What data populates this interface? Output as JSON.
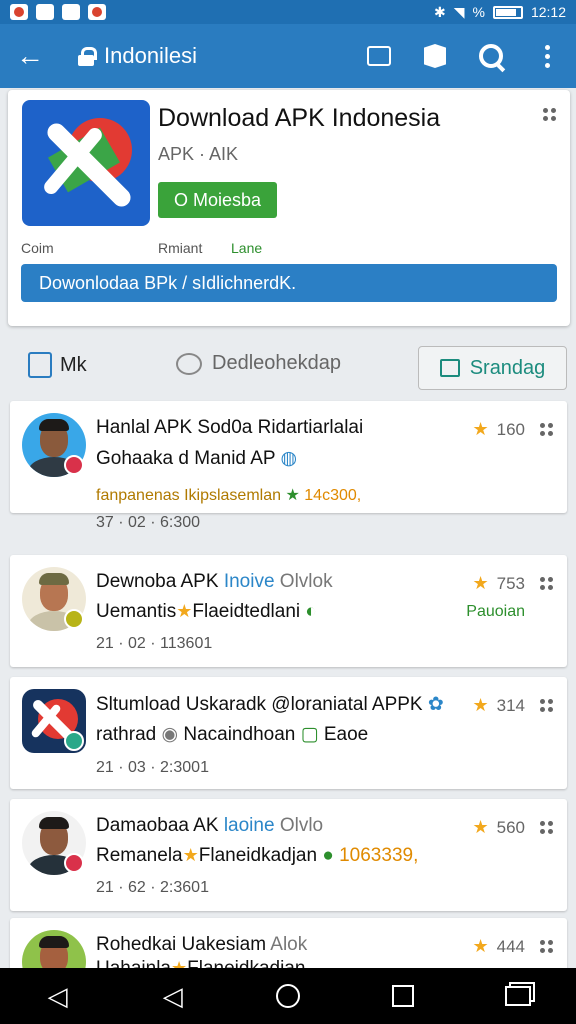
{
  "status_bar": {
    "battery_percent": "%",
    "time": "12:12"
  },
  "app_bar": {
    "title": "Indonilesi",
    "back_icon": "arrow-left-icon"
  },
  "hero": {
    "app_name": "Download APK Indonesia",
    "subtitle": "APK · AIK",
    "install_label": "O Moiesba",
    "meta": [
      "Coim",
      "Rmiant",
      "Lane"
    ],
    "banner": "Dowonlodaa BPk / sIdlichnerdK."
  },
  "actions": {
    "like_label": "Mk",
    "comment_label": "Dedleohekdap",
    "share_label": "Srandag"
  },
  "reviews": [
    {
      "line1": "Hanlal APK Sod0a Ridartiarlalai",
      "line2": "Gohaaka d Manid AP",
      "line3": "fanpanenas Ikipslasemlan",
      "line3_num": "14c300,",
      "line4": "37 · 02 · 6:300",
      "rating": "160",
      "avatar_bg": "#39a7e8",
      "badge_color": "#d9314a"
    },
    {
      "line1": "Dewnoba APK",
      "line1_tag": "Inoive",
      "line1_end": "Olvlok",
      "line2": "Uemantis",
      "line2_b": "Flaeidtedlani",
      "line2_tag": "Pauoian",
      "line4": "21 · 02 · 113601",
      "rating": "753",
      "avatar_bg": "#efe9d8",
      "badge_color": "#b8b418"
    },
    {
      "line1": "Sltumload Uskaradk @loraniatal APPK",
      "line2": "rathrad",
      "line2_b": "Nacaindhoan",
      "line2_c": "Eaoe",
      "line4": "21 · 03 · 2:3001",
      "rating": "314",
      "avatar_bg": "#16335e",
      "badge_color": "#2aa889"
    },
    {
      "line1": "Damaobaa AK",
      "line1_tag": "laoine",
      "line1_end": "Olvlo",
      "line2": "Remanela",
      "line2_b": "Flaneidkadjan",
      "line3_num": "1063339,",
      "line4": "21 · 62 · 2:3601",
      "rating": "560",
      "avatar_bg": "#f2f2f2",
      "badge_color": "#d9314a"
    },
    {
      "line1": "Rohedkai Uakesiam",
      "line1_end": "Alok",
      "line2": "Uahainla",
      "line2_b": "Flaneidkadjan",
      "rating": "444",
      "avatar_bg": "#8fc24a",
      "badge_color": "#d9314a"
    }
  ]
}
